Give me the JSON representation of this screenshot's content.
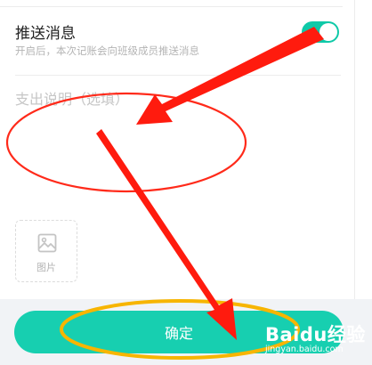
{
  "push": {
    "title": "推送消息",
    "subtitle": "开启后，本次记账会向班级成员推送消息",
    "enabled": true
  },
  "description": {
    "placeholder": "支出说明（选填）",
    "value": ""
  },
  "image_picker": {
    "icon": "image-icon",
    "label": "图片"
  },
  "footer": {
    "confirm_label": "确定"
  },
  "watermark": {
    "main": "Bai",
    "paw": "du",
    "suffix": "经验",
    "sub": "jingyan.baidu.com"
  },
  "colors": {
    "accent": "#17cfb0",
    "toggle_on": "#0fc9a8",
    "annotation_red": "#ff2a1a",
    "annotation_orange": "#f7b500"
  }
}
